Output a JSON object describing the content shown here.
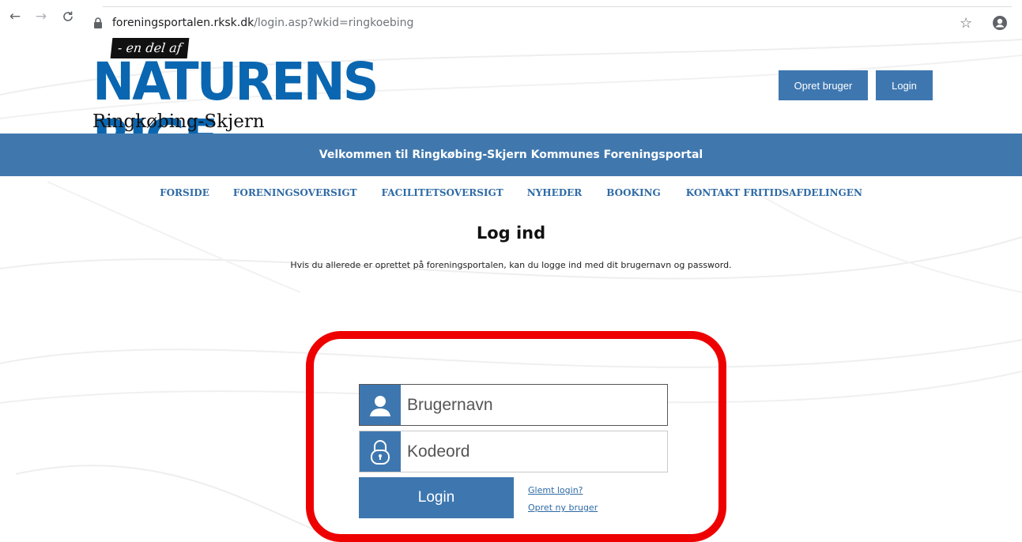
{
  "browser": {
    "url_host": "foreningsportalen.rksk.dk",
    "url_path": "/login.asp?wkid=ringkoebing"
  },
  "logo": {
    "tagline": "- en del af",
    "brand": "NATURENS RIGE",
    "subtitle": "Ringkøbing-Skjern Kommune"
  },
  "header": {
    "create_user_label": "Opret bruger",
    "login_label": "Login"
  },
  "welcome_text": "Velkommen til Ringkøbing-Skjern Kommunes Foreningsportal",
  "nav": {
    "items": [
      {
        "label": "FORSIDE"
      },
      {
        "label": "FORENINGSOVERSIGT"
      },
      {
        "label": "FACILITETSOVERSIGT"
      },
      {
        "label": "NYHEDER"
      },
      {
        "label": "BOOKING"
      },
      {
        "label": "KONTAKT FRITIDSAFDELINGEN"
      }
    ]
  },
  "login": {
    "title": "Log ind",
    "intro": "Hvis du allerede er oprettet på foreningsportalen, kan du logge ind med dit brugernavn og password.",
    "username_placeholder": "Brugernavn",
    "password_placeholder": "Kodeord",
    "submit_label": "Login",
    "forgot_label": "Glemt login?",
    "new_user_label": "Opret ny bruger"
  },
  "colors": {
    "brand_blue": "#3e77b0",
    "band_blue": "#4078ae",
    "logo_blue": "#0a66b0",
    "nav_link": "#2e6aa5",
    "highlight_red": "#ee0000"
  },
  "icons": {
    "back": "arrow-left-icon",
    "forward": "arrow-right-icon",
    "reload": "reload-icon",
    "lock": "lock-icon",
    "bookmark": "star-icon",
    "profile": "account-circle-icon",
    "user_field": "user-icon",
    "password_field": "padlock-icon"
  }
}
